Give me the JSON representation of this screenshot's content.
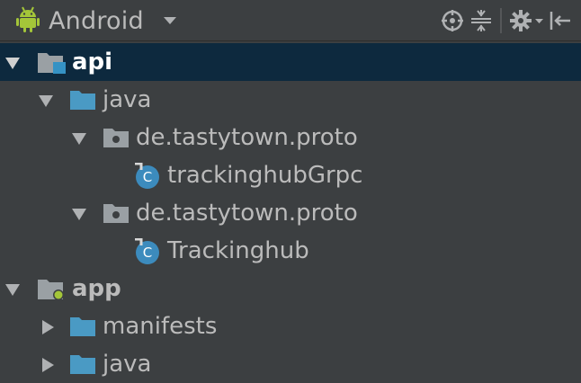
{
  "toolbar": {
    "view_name": "Android",
    "view_icon": "android-icon",
    "actions": [
      {
        "name": "locate-icon"
      },
      {
        "name": "collapse-all-icon"
      },
      {
        "name": "settings-icon"
      },
      {
        "name": "hide-panel-icon"
      }
    ]
  },
  "colors": {
    "background": "#3c3f41",
    "selected_row": "#0d293e",
    "folder": "#4a9ac4",
    "android_green": "#a4c639",
    "class_icon": "#3c8bbd"
  },
  "tree": [
    {
      "label": "api",
      "type": "module",
      "expanded": true,
      "selected": true
    },
    {
      "label": "java",
      "type": "folder",
      "expanded": true
    },
    {
      "label": "de.tastytown.proto",
      "type": "package",
      "expanded": true
    },
    {
      "label": "trackinghubGrpc",
      "type": "class"
    },
    {
      "label": "de.tastytown.proto",
      "type": "package",
      "expanded": true
    },
    {
      "label": "Trackinghub",
      "type": "class"
    },
    {
      "label": "app",
      "type": "module",
      "expanded": true
    },
    {
      "label": "manifests",
      "type": "folder",
      "expanded": false
    },
    {
      "label": "java",
      "type": "folder",
      "expanded": false
    }
  ]
}
